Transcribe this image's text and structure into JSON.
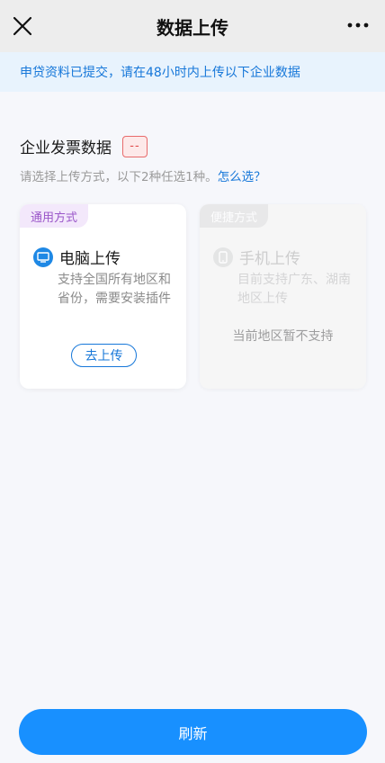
{
  "nav": {
    "title": "数据上传",
    "close_icon": "close-icon",
    "more_icon": "more-icon"
  },
  "notice": {
    "text": "申贷资料已提交，请在48小时内上传以下企业数据"
  },
  "section": {
    "title": "企业发票数据",
    "status": "--",
    "hint": "请选择上传方式，以下2种任选1种。",
    "hint_link": "怎么选？"
  },
  "cards": [
    {
      "tag": "通用方式",
      "icon": "monitor-icon",
      "name": "电脑上传",
      "desc": "支持全国所有地区和省份，需要安装插件",
      "button": "去上传"
    },
    {
      "tag": "便捷方式",
      "icon": "phone-icon",
      "name": "手机上传",
      "desc": "目前支持广东、湖南地区上传",
      "status": "当前地区暂不支持"
    }
  ],
  "refresh": {
    "label": "刷新"
  },
  "colors": {
    "primary": "#1890ff",
    "link": "#1677d9",
    "notice_bg": "#e8f3fd",
    "tag_purple": "#9a56c9",
    "badge_red": "#e04a4a"
  }
}
